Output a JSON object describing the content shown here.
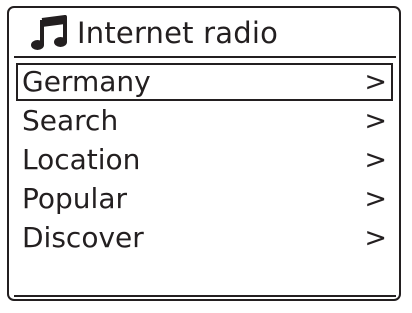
{
  "header": {
    "icon": "music-note-icon",
    "title": "Internet radio"
  },
  "menu": {
    "selected_index": 0,
    "items": [
      {
        "label": "Germany",
        "arrow": ">"
      },
      {
        "label": "Search",
        "arrow": ">"
      },
      {
        "label": "Location",
        "arrow": ">"
      },
      {
        "label": "Popular",
        "arrow": ">"
      },
      {
        "label": "Discover",
        "arrow": ">"
      }
    ]
  },
  "colors": {
    "foreground": "#231f20",
    "background": "#ffffff"
  }
}
